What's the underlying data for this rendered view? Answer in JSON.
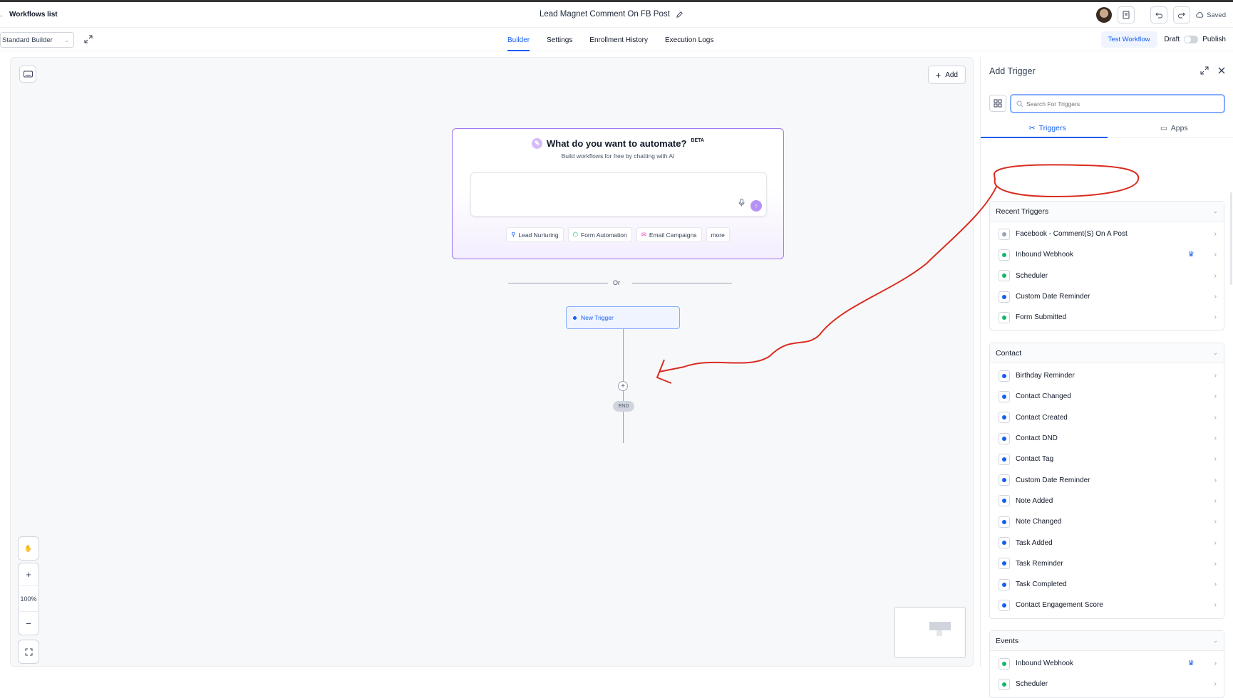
{
  "header": {
    "back_label": "Workflows list",
    "title": "Lead Magnet Comment On FB Post",
    "saved_label": "Saved"
  },
  "subbar": {
    "builder_mode": "Standard Builder",
    "tabs": [
      "Builder",
      "Settings",
      "Enrollment History",
      "Execution Logs"
    ],
    "test_label": "Test Workflow",
    "draft_label": "Draft",
    "publish_label": "Publish"
  },
  "canvas": {
    "add_label": "Add",
    "ai": {
      "title": "What do you want to automate?",
      "beta": "BETA",
      "subtitle": "Build workflows for free by chatting with AI",
      "chips": [
        "Lead Nurturing",
        "Form Automation",
        "Email Campaigns",
        "more"
      ]
    },
    "or_label": "Or",
    "trigger_label": "New Trigger",
    "end_label": "END",
    "zoom": "100%"
  },
  "panel": {
    "title": "Add Trigger",
    "search_placeholder": "Search For Triggers",
    "tabs": [
      "Triggers",
      "Apps"
    ],
    "sections": [
      {
        "title": "Recent Triggers",
        "items": [
          {
            "label": "Facebook - Comment(S) On A Post",
            "icon": "facebook-icon"
          },
          {
            "label": "Inbound Webhook",
            "icon": "webhook-icon",
            "premium": true
          },
          {
            "label": "Scheduler",
            "icon": "clock-icon"
          },
          {
            "label": "Custom Date Reminder",
            "icon": "calendar-icon"
          },
          {
            "label": "Form Submitted",
            "icon": "form-icon"
          }
        ]
      },
      {
        "title": "Contact",
        "items": [
          {
            "label": "Birthday Reminder",
            "icon": "cake-icon"
          },
          {
            "label": "Contact Changed",
            "icon": "contact-icon"
          },
          {
            "label": "Contact Created",
            "icon": "user-plus-icon"
          },
          {
            "label": "Contact DND",
            "icon": "dnd-icon"
          },
          {
            "label": "Contact Tag",
            "icon": "tag-icon"
          },
          {
            "label": "Custom Date Reminder",
            "icon": "calendar-icon"
          },
          {
            "label": "Note Added",
            "icon": "note-icon"
          },
          {
            "label": "Note Changed",
            "icon": "notes-icon"
          },
          {
            "label": "Task Added",
            "icon": "check-icon"
          },
          {
            "label": "Task Reminder",
            "icon": "bell-icon"
          },
          {
            "label": "Task Completed",
            "icon": "checkbox-icon"
          },
          {
            "label": "Contact Engagement Score",
            "icon": "trophy-icon"
          }
        ]
      },
      {
        "title": "Events",
        "items": [
          {
            "label": "Inbound Webhook",
            "icon": "webhook-icon",
            "premium": true
          },
          {
            "label": "Scheduler",
            "icon": "clock-icon"
          }
        ]
      }
    ]
  },
  "colors": {
    "accent": "#155eef",
    "ai_border": "#9e77ed",
    "annotation": "#d92d20"
  }
}
